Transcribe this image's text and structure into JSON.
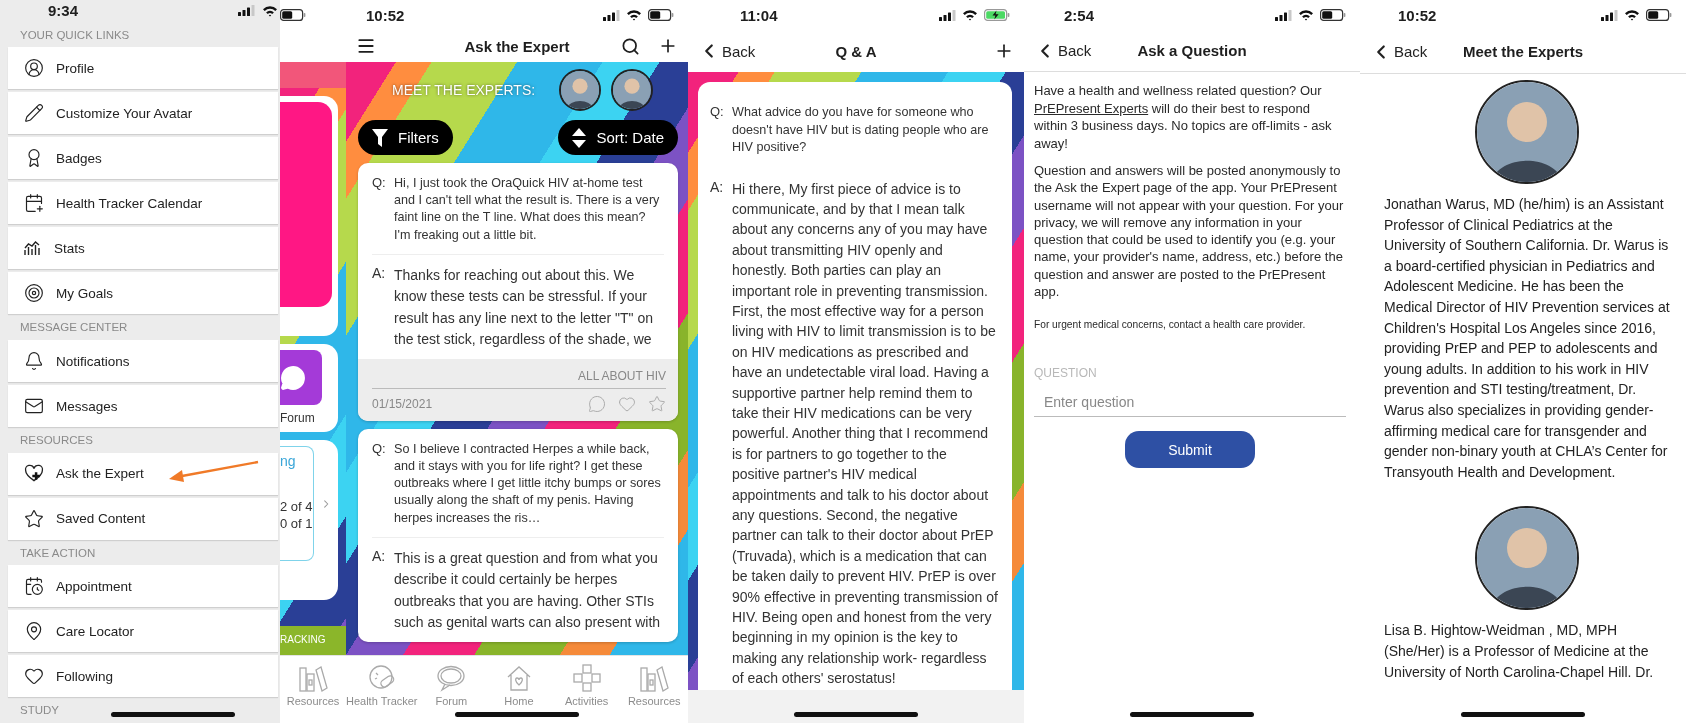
{
  "menu": {
    "status_bar": {
      "time": "9:34",
      "charging": false
    },
    "sections": [
      {
        "title": "YOUR QUICK LINKS",
        "items": [
          {
            "label": "Profile",
            "highlighted": false
          },
          {
            "label": "Customize Your Avatar",
            "highlighted": false
          },
          {
            "label": "Badges",
            "highlighted": false
          },
          {
            "label": "Health Tracker Calendar",
            "highlighted": false
          },
          {
            "label": "Stats",
            "highlighted": false
          },
          {
            "label": "My Goals",
            "highlighted": false
          }
        ]
      },
      {
        "title": "MESSAGE CENTER",
        "items": [
          {
            "label": "Notifications",
            "highlighted": false
          },
          {
            "label": "Messages",
            "highlighted": false
          }
        ]
      },
      {
        "title": "RESOURCES",
        "items": [
          {
            "label": "Ask the Expert",
            "highlighted": true
          },
          {
            "label": "Saved Content",
            "highlighted": false
          }
        ]
      },
      {
        "title": "TAKE ACTION",
        "items": [
          {
            "label": "Appointment",
            "highlighted": false
          },
          {
            "label": "Care Locator",
            "highlighted": false
          },
          {
            "label": "Following",
            "highlighted": false
          }
        ]
      },
      {
        "title": "STUDY"
      }
    ]
  },
  "home_behind": {
    "forum_label": "Forum",
    "progress_title": "ng",
    "progress_lines": [
      "2 of 4",
      "0 of 1"
    ],
    "banner": "RACKING",
    "nav_items": [
      {
        "label": "Resources"
      }
    ]
  },
  "ask_the_expert": {
    "status_bar": {
      "time": "10:52",
      "charging": false
    },
    "title": "Ask the Expert",
    "experts_label": "MEET THE EXPERTS:",
    "experts": [
      {
        "kind": "avatar"
      },
      {
        "kind": "avatar"
      }
    ],
    "filters": "Filters",
    "sort": "Sort: Date",
    "posts": [
      {
        "q_label": "Q:",
        "question": "Hi, I just took the OraQuick HIV at-home test and I can't tell what the result is. There is a very faint line on the T line. What does this mean? I'm freaking out a little bit.",
        "a_label": "A:",
        "answer": "Thanks for reaching out about this. We know these tests can be stressful. If your result has any line next to the letter \"T\" on the test stick, regardless of the shade, we",
        "topic": "ALL ABOUT HIV",
        "date": "01/15/2021"
      },
      {
        "q_label": "Q:",
        "question": "So I believe I contracted Herpes a while back, and it stays with you for life right? I get these outbreaks where I get little itchy bumps or sores usually along the shaft of my penis. Having herpes increases the ris…",
        "a_label": "A:",
        "answer": "This is a great question and from what you describe it could certainly be herpes outbreaks that you are having. Other STIs such as genital warts can also present with"
      }
    ],
    "nav_items": [
      {
        "label": "Health Tracker"
      },
      {
        "label": "Forum"
      },
      {
        "label": "Home"
      },
      {
        "label": "Activities"
      },
      {
        "label": "Resources"
      }
    ]
  },
  "qa": {
    "status_bar": {
      "time": "11:04",
      "charging": true
    },
    "back": "Back",
    "title": "Q & A",
    "q_label": "Q:",
    "question": "What advice do you have for someone who doesn't have HIV but is dating people who are HIV positive?",
    "a_label": "A:",
    "answer": "Hi there, My first piece of advice is to communicate, and by that I mean talk about any concerns any of you may have about transmitting HIV openly and honestly. Both parties can play an important role in preventing transmission. First, the most effective way for a person living with HIV to limit transmission is to be on HIV medications as prescribed and have an undetectable viral load. Having a supportive partner help remind them to take their HIV medications can be very powerful. Another thing that I recommend is for partners to go together to the positive partner's HIV medical appointments and talk to his doctor about any questions. Second, the negative partner can talk to their doctor about PrEP (Truvada), which is a medication that can be taken daily to prevent HIV. PrEP is over 90% effective in preventing transmission of HIV. Being open and honest from the very beginning in my opinion is the key to making any relationship work- regardless of each others' serostatus!"
  },
  "ask_question": {
    "status_bar": {
      "time": "2:54",
      "charging": false
    },
    "back": "Back",
    "title": "Ask a Question",
    "intro_before": "Have a health and wellness related question? Our ",
    "intro_link": "PrEPresent Experts",
    "intro_after": " will do their best to respond within 3 business days. No topics are off-limits - ask away!",
    "privacy": "Question and answers will be posted anonymously to the Ask the Expert page of the app. Your PrEPresent username will not appear with your question. For your privacy, we will remove any information in your question that could be used to identify you (e.g. your name, your provider's name, address, etc.) before the question and answer are posted to the PrEPresent app.",
    "note": "For urgent medical concerns, contact a health care provider.",
    "field_label": "QUESTION",
    "placeholder": "Enter question",
    "submit": "Submit"
  },
  "meet_experts": {
    "status_bar": {
      "time": "10:52",
      "charging": false
    },
    "back": "Back",
    "title": "Meet the Experts",
    "experts": [
      {
        "kind": "avatar",
        "bio": "Jonathan Warus, MD (he/him) is an Assistant Professor of Clinical Pediatrics at the University of Southern California. Dr. Warus is a board-certified physician in Pediatrics and Adolescent Medicine. He has been the Medical Director of HIV Prevention services at Children's Hospital Los Angeles since 2016, providing PrEP and PEP to adolescents and young adults. In addition to his work in HIV prevention and STI testing/treatment, Dr. Warus also specializes in providing gender-affirming medical care for transgender and gender non-binary youth at CHLA’s Center for Transyouth Health and Development."
      },
      {
        "kind": "avatar",
        "bio": "Lisa B. Hightow-Weidman , MD, MPH (She/Her) is a Professor of Medicine at the University of North Carolina-Chapel Hill. Dr."
      }
    ]
  }
}
